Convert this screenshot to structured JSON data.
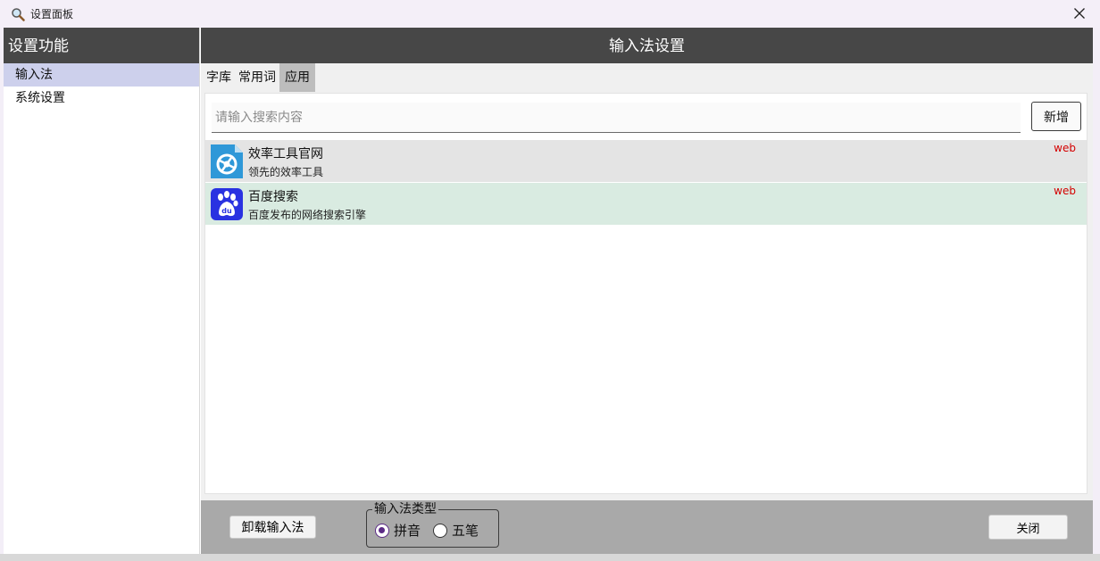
{
  "window": {
    "title": "设置面板"
  },
  "sidebar": {
    "header": "设置功能",
    "items": [
      {
        "label": "输入法",
        "active": true
      },
      {
        "label": "系统设置",
        "active": false
      }
    ]
  },
  "main": {
    "header": "输入法设置",
    "tabs": [
      {
        "label": "字库",
        "active": false
      },
      {
        "label": "常用词",
        "active": false
      },
      {
        "label": "应用",
        "active": true
      }
    ],
    "search": {
      "placeholder": "请输入搜索内容",
      "value": ""
    },
    "add_label": "新增",
    "list": [
      {
        "name": "效率工具官网",
        "desc": "领先的效率工具",
        "tag": "web",
        "icon": "efficiency-tool-icon",
        "bg": "#e4e4e4"
      },
      {
        "name": "百度搜索",
        "desc": "百度发布的网络搜索引擎",
        "tag": "web",
        "icon": "baidu-icon",
        "bg": "#d9ebe1"
      }
    ]
  },
  "bottom": {
    "uninstall_label": "卸载输入法",
    "ime_type_legend": "输入法类型",
    "ime_options": [
      {
        "label": "拼音",
        "checked": true
      },
      {
        "label": "五笔",
        "checked": false
      }
    ],
    "close_label": "关闭"
  },
  "colors": {
    "header_bg": "#474747",
    "sidebar_active": "#cdd0ec",
    "tag_red": "#d40000",
    "radio_checked": "#5b2a86",
    "bottom_bar": "#a9a9a9"
  }
}
